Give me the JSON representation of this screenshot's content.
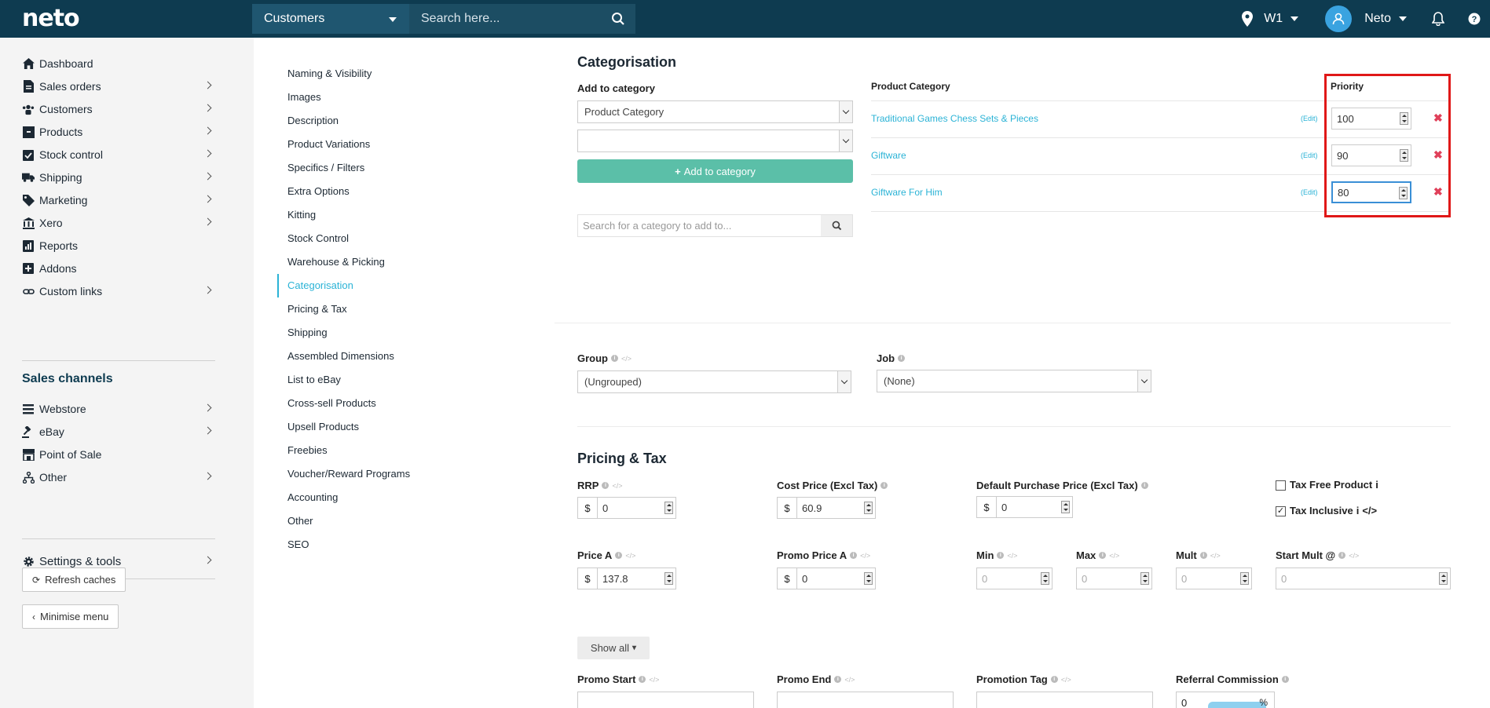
{
  "topbar": {
    "logo": "neto",
    "search_scope": "Customers",
    "search_placeholder": "Search here...",
    "location": "W1",
    "user": "Neto"
  },
  "sidebar": {
    "items": [
      {
        "label": "Dashboard",
        "icon": "home-icon"
      },
      {
        "label": "Sales orders",
        "icon": "document-icon"
      },
      {
        "label": "Customers",
        "icon": "users-icon"
      },
      {
        "label": "Products",
        "icon": "box-icon"
      },
      {
        "label": "Stock control",
        "icon": "clipboard-icon"
      },
      {
        "label": "Shipping",
        "icon": "truck-icon"
      },
      {
        "label": "Marketing",
        "icon": "tag-icon"
      },
      {
        "label": "Xero",
        "icon": "bank-icon"
      },
      {
        "label": "Reports",
        "icon": "reports-icon"
      },
      {
        "label": "Addons",
        "icon": "plus-square-icon"
      },
      {
        "label": "Custom links",
        "icon": "link-icon"
      }
    ],
    "channels_heading": "Sales channels",
    "channels": [
      {
        "label": "Webstore",
        "icon": "list-icon"
      },
      {
        "label": "eBay",
        "icon": "gavel-icon"
      },
      {
        "label": "Point of Sale",
        "icon": "store-icon"
      },
      {
        "label": "Other",
        "icon": "sitemap-icon"
      }
    ],
    "settings": "Settings & tools",
    "refresh": "Refresh caches",
    "minimise": "Minimise menu"
  },
  "section_nav": [
    "Naming & Visibility",
    "Images",
    "Description",
    "Product Variations",
    "Specifics / Filters",
    "Extra Options",
    "Kitting",
    "Stock Control",
    "Warehouse & Picking",
    "Categorisation",
    "Pricing & Tax",
    "Shipping",
    "Assembled Dimensions",
    "List to eBay",
    "Cross-sell Products",
    "Upsell Products",
    "Freebies",
    "Voucher/Reward Programs",
    "Accounting",
    "Other",
    "SEO"
  ],
  "categorisation": {
    "title": "Categorisation",
    "add_label": "Add to category",
    "select1": "Product Category",
    "select2": "",
    "add_button": "Add to category",
    "search_placeholder": "Search for a category to add to...",
    "col_category": "Product Category",
    "col_priority": "Priority",
    "edit_label": "(Edit)",
    "rows": [
      {
        "name": "Traditional Games Chess Sets & Pieces",
        "priority": "100"
      },
      {
        "name": "Giftware",
        "priority": "90"
      },
      {
        "name": "Giftware For Him",
        "priority": "80"
      }
    ]
  },
  "group_job": {
    "group_label": "Group",
    "group_value": "(Ungrouped)",
    "job_label": "Job",
    "job_value": "(None)"
  },
  "pricing": {
    "title": "Pricing & Tax",
    "rrp_label": "RRP",
    "rrp_value": "0",
    "cost_label": "Cost Price (Excl Tax)",
    "cost_value": "60.9",
    "default_purchase_label": "Default Purchase Price (Excl Tax)",
    "default_purchase_value": "0",
    "tax_free_label": "Tax Free Product",
    "tax_inclusive_label": "Tax Inclusive",
    "currency": "$",
    "price_a_label": "Price A",
    "price_a_value": "137.8",
    "promo_price_label": "Promo Price A",
    "promo_price_value": "0",
    "min_label": "Min",
    "min_value": "0",
    "max_label": "Max",
    "max_value": "0",
    "mult_label": "Mult",
    "mult_value": "0",
    "start_mult_label": "Start Mult @",
    "start_mult_value": "0",
    "show_all": "Show all",
    "promo_start_label": "Promo Start",
    "promo_end_label": "Promo End",
    "promotion_tag_label": "Promotion Tag",
    "referral_label": "Referral Commission",
    "referral_value": "0",
    "referral_unit": "%"
  }
}
